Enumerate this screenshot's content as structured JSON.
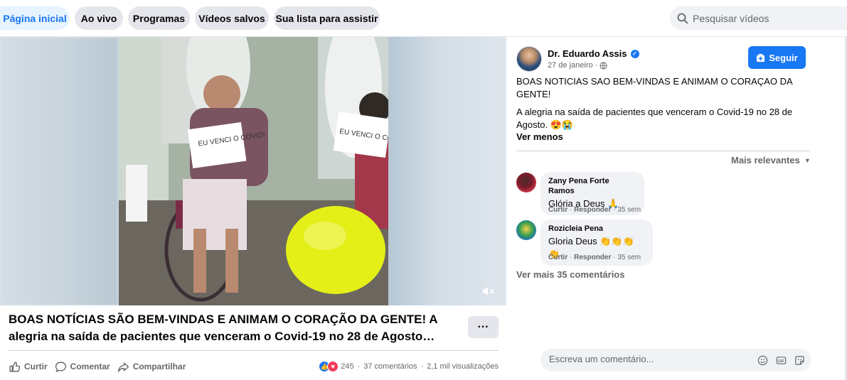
{
  "nav": {
    "tabs": [
      {
        "label": "Página inicial",
        "active": true
      },
      {
        "label": "Ao vivo",
        "active": false
      },
      {
        "label": "Programas",
        "active": false
      },
      {
        "label": "Vídeos salvos",
        "active": false
      },
      {
        "label": "Sua lista para assistir",
        "active": false
      }
    ],
    "search_placeholder": "Pesquisar vídeos"
  },
  "video": {
    "title": "BOAS NOTÍCIAS SÃO BEM-VINDAS E ANIMAM O CORAÇÃO DA GENTE! A alegria na saída de pacientes que venceram o Covid-19 no 28 de Agosto…",
    "sign_left": "EU VENCI O COVID!",
    "sign_right": "EU VENCI O COVID!",
    "more_label": "···",
    "actions": {
      "like": "Curtir",
      "comment": "Comentar",
      "share": "Compartilhar"
    },
    "reaction_count": "245",
    "comments_count": "37 comentários",
    "views": "2,1 mil visualizações",
    "stat_separator": "·"
  },
  "post": {
    "author": "Dr. Eduardo Assis",
    "date": "27 de janeiro",
    "date_separator": "·",
    "follow_label": "Seguir",
    "text1": "BOAS NOTICIAS SAO BEM-VINDAS E ANIMAM O CORAÇAO DA GENTE!",
    "text2": "A alegria na saída de pacientes que venceram o Covid-19 no 28 de Agosto. 😍😭",
    "see_less": "Ver menos",
    "sort_label": "Mais relevantes"
  },
  "comments": [
    {
      "name": "Zany Pena Forte Ramos",
      "text": "Glória a Deus 🙏",
      "like": "Curtir",
      "reply": "Responder",
      "time": "35 sem"
    },
    {
      "name": "Rozicleia Pena",
      "text": "Gloria Deus 👏👏👏👏",
      "like": "Curtir",
      "reply": "Responder",
      "time": "35 sem"
    }
  ],
  "meta_separator": "·",
  "more_comments": "Ver mais 35 comentários",
  "composer_placeholder": "Escreva um comentário...",
  "colors": {
    "accent": "#1877f2",
    "tab_bg": "#e4e6eb",
    "active_tab_bg": "#e7f3ff",
    "secondary_text": "#65676b"
  }
}
